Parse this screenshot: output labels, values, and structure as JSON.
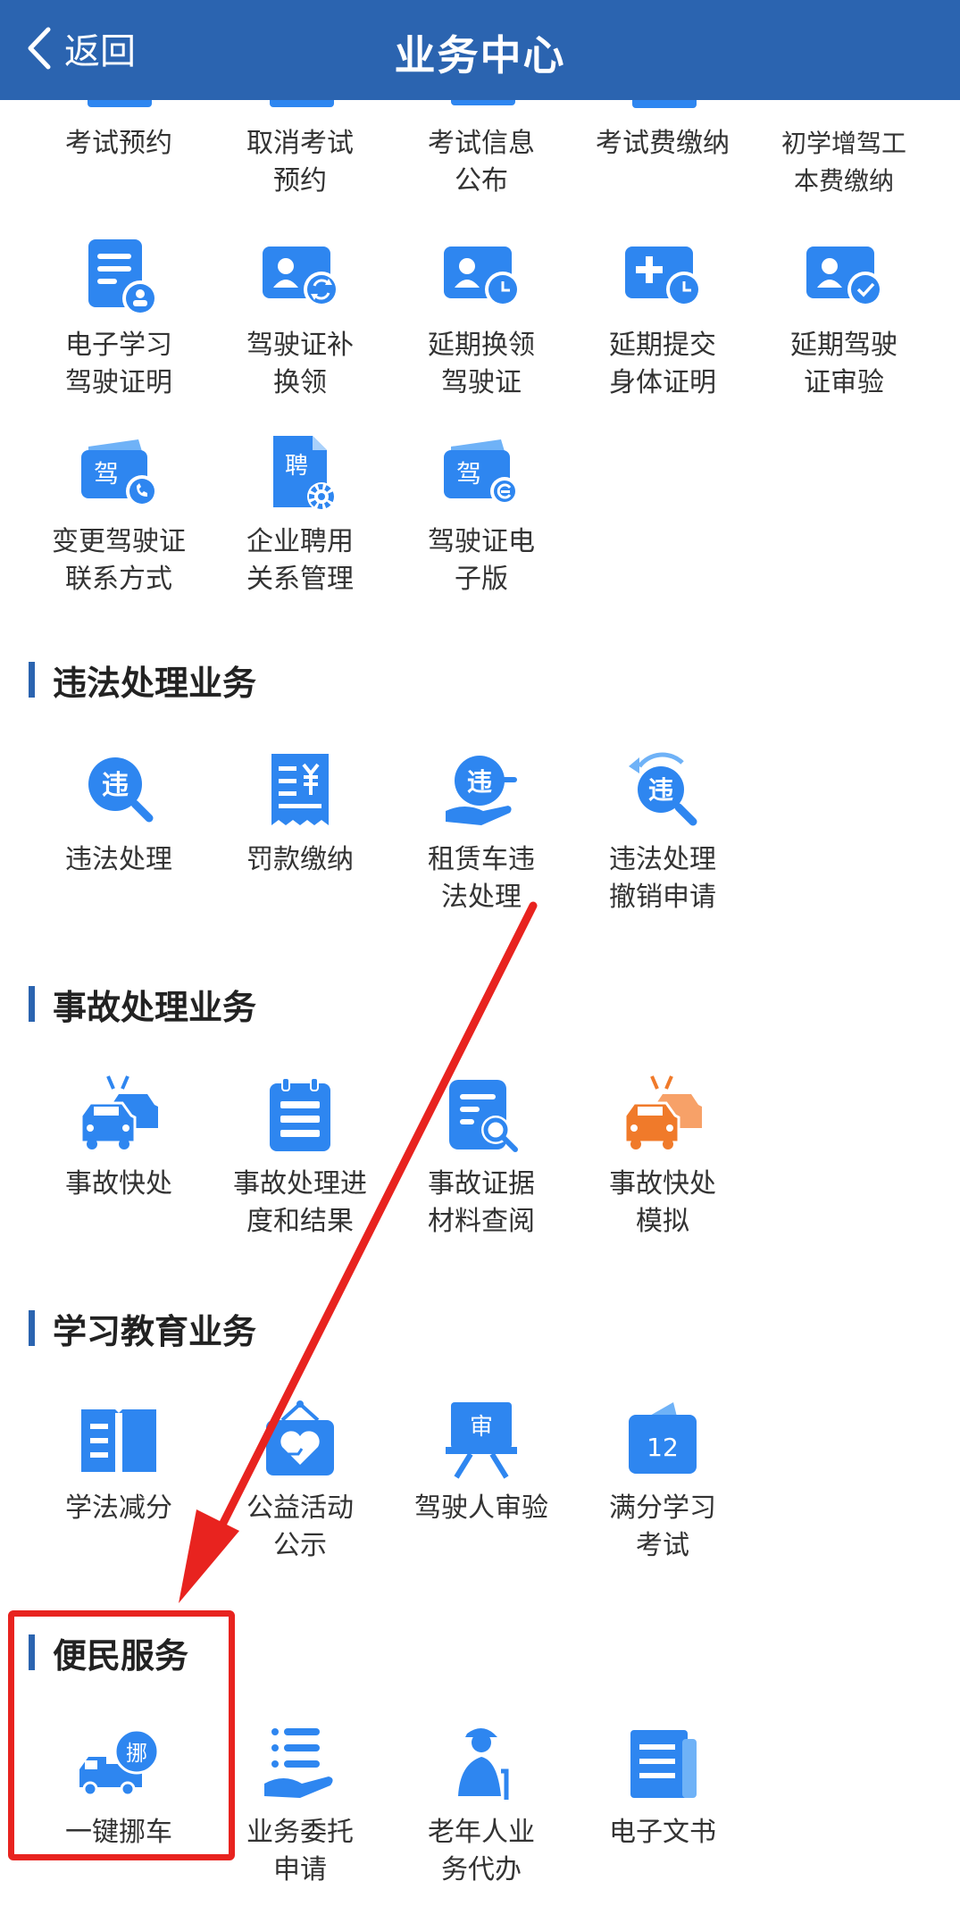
{
  "header": {
    "back_label": "返回",
    "title": "业务中心"
  },
  "driving": {
    "row1": [
      "考试预约",
      "取消考试\n预约",
      "考试信息\n公布",
      "考试费缴纳",
      "初学增驾工\n本费缴纳"
    ],
    "row2": [
      "电子学习\n驾驶证明",
      "驾驶证补\n换领",
      "延期换领\n驾驶证",
      "延期提交\n身体证明",
      "延期驾驶\n证审验"
    ],
    "row3": [
      "变更驾驶证\n联系方式",
      "企业聘用\n关系管理",
      "驾驶证电\n子版"
    ],
    "icon_glyphs": {
      "jia": "驾",
      "pin": "聘"
    }
  },
  "violation": {
    "title": "违法处理业务",
    "items": [
      "违法处理",
      "罚款缴纳",
      "租赁车违\n法处理",
      "违法处理\n撤销申请"
    ],
    "icon_glyph": "违"
  },
  "accident": {
    "title": "事故处理业务",
    "items": [
      "事故快处",
      "事故处理进\n度和结果",
      "事故证据\n材料查阅",
      "事故快处\n模拟"
    ]
  },
  "education": {
    "title": "学习教育业务",
    "items": [
      "学法减分",
      "公益活动\n公示",
      "驾驶人审验",
      "满分学习\n考试"
    ],
    "icon_glyphs": {
      "shen": "审",
      "twelve": "12"
    }
  },
  "convenience": {
    "title": "便民服务",
    "items": [
      "一键挪车",
      "业务委托\n申请",
      "老年人业\n务代办",
      "电子文书"
    ],
    "icon_glyph": "挪"
  },
  "colors": {
    "header": "#2b64b0",
    "icon_blue": "#2e86f0",
    "icon_orange": "#f07a2a",
    "annotation_red": "#e8231f"
  }
}
